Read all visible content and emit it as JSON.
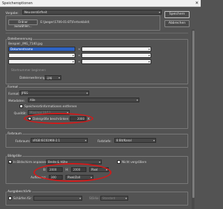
{
  "window": {
    "title": "Speicheroptionen",
    "close_glyph": "✕"
  },
  "buttons": {
    "save": "Speichern",
    "cancel": "Abbrechen"
  },
  "target": {
    "label": "Vorgabe:",
    "value": "Neu-zerstörfheit",
    "folder_button": "Ordner auswählen...",
    "folder_path": "E:\\Jaeger\\1706-01-BT\\Fertsekbild\\"
  },
  "file_naming": {
    "title": "Dateibenennung",
    "example_label": "Beispiel:",
    "example_value": "_IMG_7140.jpg",
    "row1_left": "Dokumentname",
    "start_number_label": "Startnummer beginnen:",
    "extension_label": "Dateierweiterung:",
    "extension_value": ".jpg"
  },
  "format": {
    "title": "Format",
    "format_label": "Format:",
    "format_value": "JPEG",
    "metadata_label": "Metadaten:",
    "metadata_value": "Alle",
    "remove_location_label": "Speicherortinformationen entfernen",
    "quality_label": "Qualität:",
    "quality_value": "Maximal 10/12",
    "limit_size_label": "Dateigröße beschränken auf:",
    "limit_size_value": "2000",
    "limit_size_unit": "K"
  },
  "color_space": {
    "title": "Farbraum",
    "profile_label": "Farbraum:",
    "profile_value": "sRGB IEC61966-2.1",
    "depth_label": "Farbtiefe:",
    "depth_value": "8 Bit/Kanal"
  },
  "image_size": {
    "title": "Bildgröße",
    "fit_label": "In Bildschirm anpassen:",
    "fit_value": "Breite & Höhe",
    "no_enlarge_label": "Nicht vergrößern",
    "w_label": "B:",
    "w_value": "2000",
    "h_label": "H:",
    "h_value": "2000",
    "unit_value": "Pixel",
    "resolution_label": "Auflösung:",
    "resolution_value": "300",
    "resolution_unit": "Pixel/Zoll"
  },
  "output_sharpening": {
    "title": "Ausgabeschärfe",
    "sharpen_label": "Schärfen für:",
    "amount_label": "Stärke:",
    "amount_value": "Standard"
  },
  "colors": {
    "highlight": "#d11a1a",
    "selection": "#2e63c4"
  }
}
